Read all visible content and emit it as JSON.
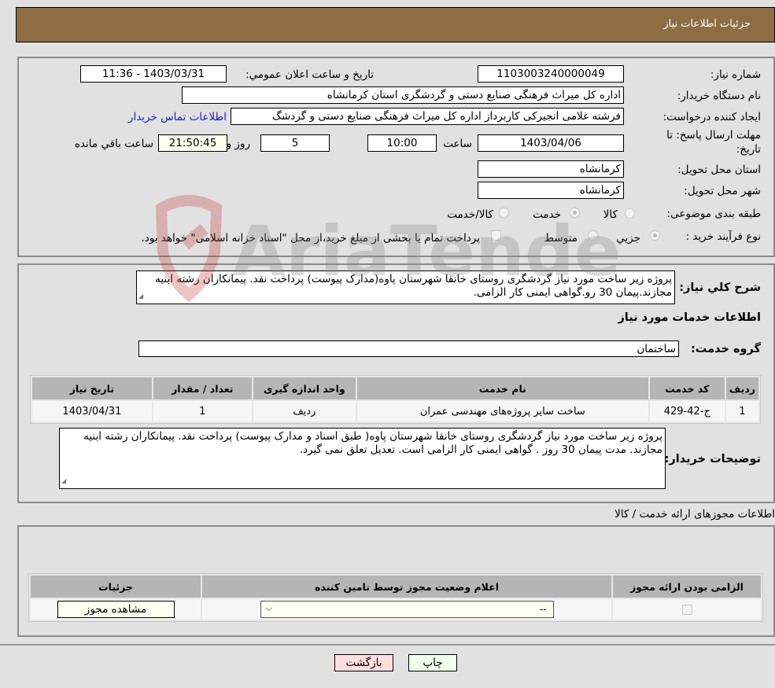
{
  "header": {
    "title": "جزئیات اطلاعات نیاز"
  },
  "need_info": {
    "need_number_label": "شماره نیاز:",
    "need_number": "1103003240000049",
    "announce_label": "تاريخ و ساعت اعلان عمومي:",
    "announce_value": "1403/03/31 - 11:36",
    "buyer_org_label": "نام دستگاه خریدار:",
    "buyer_org": "اداره کل میراث فرهنگی  صنایع دستی و گردشگری استان کرمانشاه",
    "creator_label": "ایجاد کننده درخواست:",
    "creator": "فرشته غلامی انجیرکی کاربرداز اداره کل میراث فرهنگی  صنایع دستی و گردشگ",
    "contact_link": "اطلاعات تماس خریدار",
    "deadline_label_line1": "مهلت ارسال پاسخ: تا",
    "deadline_label_line2": "تاریخ:",
    "deadline_date": "1403/04/06",
    "time_label": "ساعت",
    "deadline_time": "10:00",
    "days_value": "5",
    "days_label": "روز و",
    "remaining_time": "21:50:45",
    "remaining_label": "ساعت باقي مانده",
    "province_label": "استان محل تحویل:",
    "province": "کرمانشاه",
    "city_label": "شهر محل تحویل:",
    "city": "کرمانشاه",
    "category_label": "طبقه بندی موضوعی:",
    "category_options": [
      {
        "label": "کالا",
        "selected": false
      },
      {
        "label": "خدمت",
        "selected": true
      },
      {
        "label": "کالا/خدمت",
        "selected": false
      }
    ],
    "process_label": "نوع فرآیند خرید :",
    "process_options": [
      {
        "label": "جزيي",
        "selected": true
      },
      {
        "label": "متوسط",
        "selected": false
      }
    ],
    "treasury_checkbox_label": "پرداخت تمام یا بخشی از مبلغ خرید،از محل \"اسناد خزانه اسلامی\" خواهد بود."
  },
  "description": {
    "general_label": "شرح کلي نياز:",
    "general_text": "پروژه زیر ساخت مورد نیاز گردشگری روستای خانقا شهرستان پاوه(مدارک پیوست) پرداخت نقد. پیمانکاران رشته ابنیه مجازند.پیمان 30 رو.گواهی ایمنی کار الزامی.",
    "services_heading": "اطلاعات خدمات مورد نیاز",
    "service_group_label": "گروه خدمت:",
    "service_group": "ساختمان"
  },
  "services_table": {
    "headers": [
      "ردیف",
      "کد خدمت",
      "نام خدمت",
      "واحد اندازه گیری",
      "تعداد / مقدار",
      "تاریخ نیاز"
    ],
    "rows": [
      [
        "1",
        "ج-42-429",
        "ساخت سایر پروژه‌های مهندسی عمران",
        "ردیف",
        "1",
        "1403/04/31"
      ]
    ]
  },
  "buyer_notes": {
    "label": "توضیحات خریدار:",
    "text": "پروژه زیر ساخت مورد نیاز گردشگری روستای خانقا شهرستان پاوه( طبق اسناد و مدارک پیوست) پرداخت نقد. پیمانکاران رشته ابنیه مجازند. مدت پیمان 30 روز . گواهی ایمنی کار الزامی است. تعدیل تعلق نمی گیرد."
  },
  "licenses": {
    "heading": "اطلاعات مجوزهای ارائه خدمت / کالا",
    "headers": [
      "الزامی بودن ارائه مجوز",
      "اعلام وضعیت مجوز توسط تامین کننده",
      "جزئیات"
    ],
    "row": {
      "required_checked": true,
      "status_selected": "--",
      "view_button": "مشاهده مجوز"
    }
  },
  "footer": {
    "print_button": "چاپ",
    "back_button": "بازگشت"
  },
  "watermark": {
    "text": "AriaTender.neT"
  },
  "colors": {
    "header_bg": "#8d6d43",
    "back_button_bg": "#ffdede",
    "print_button_bg": "#efffea",
    "highlight_field_bg": "#fffff0",
    "link": "#2020c0"
  }
}
